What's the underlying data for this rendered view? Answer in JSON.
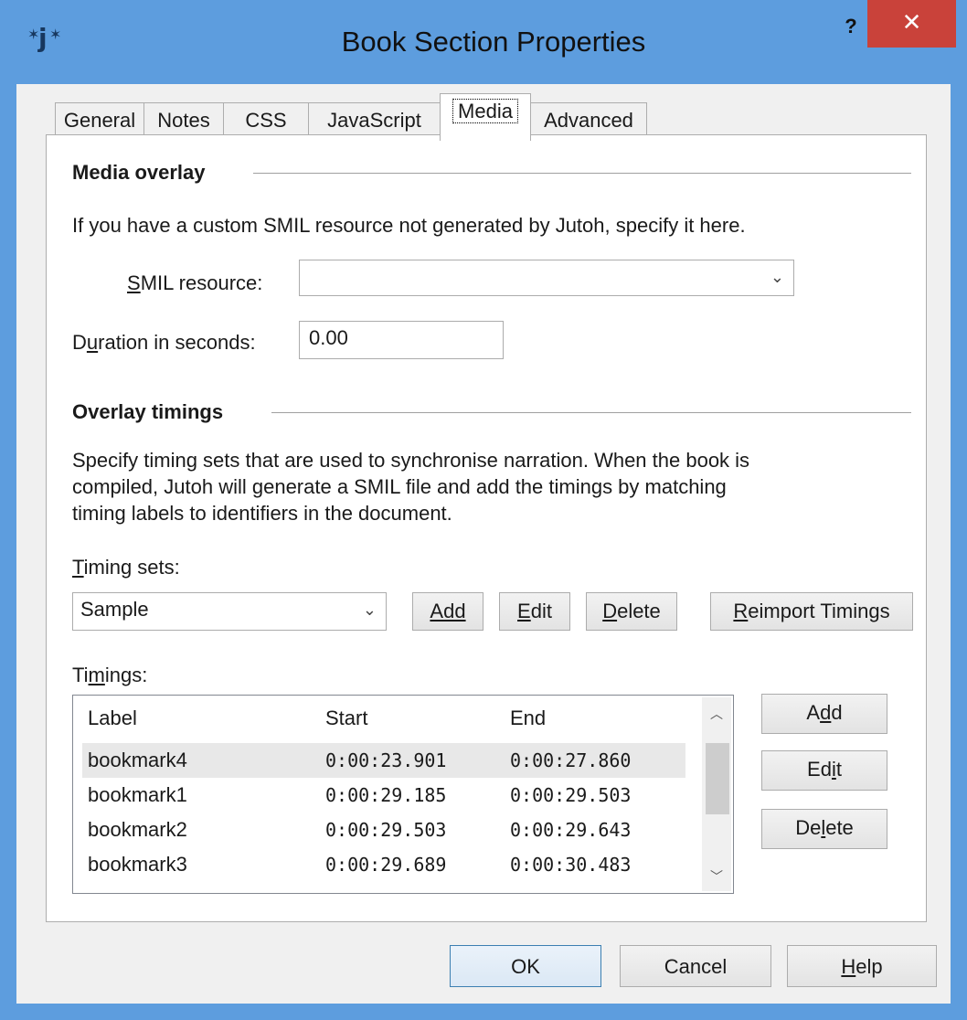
{
  "window": {
    "title": "Book Section Properties",
    "help_glyph": "?",
    "close_glyph": "✕",
    "app_icon_glyph": "j"
  },
  "tabs": [
    "General",
    "Notes",
    "CSS",
    "JavaScript",
    "Media",
    "Advanced"
  ],
  "active_tab": "Media",
  "media_overlay": {
    "heading": "Media overlay",
    "description": "If you have a custom SMIL resource not generated by Jutoh, specify it here.",
    "smil_label": "SMIL resource:",
    "smil_value": "",
    "duration_label": "Duration in seconds:",
    "duration_value": "0.00"
  },
  "overlay_timings": {
    "heading": "Overlay timings",
    "description_lines": [
      "Specify timing sets that are used to synchronise narration. When the book is",
      "compiled, Jutoh will generate a SMIL file and add the timings by matching",
      "timing labels to identifiers in the document."
    ],
    "timing_sets_label": "Timing sets:",
    "timing_set_value": "Sample",
    "set_buttons": [
      "Add",
      "Edit",
      "Delete",
      "Reimport Timings"
    ],
    "timings_label": "Timings:",
    "columns": [
      "Label",
      "Start",
      "End"
    ],
    "rows": [
      {
        "label": "bookmark4",
        "start": "0:00:23.901",
        "end": "0:00:27.860"
      },
      {
        "label": "bookmark1",
        "start": "0:00:29.185",
        "end": "0:00:29.503"
      },
      {
        "label": "bookmark2",
        "start": "0:00:29.503",
        "end": "0:00:29.643"
      },
      {
        "label": "bookmark3",
        "start": "0:00:29.689",
        "end": "0:00:30.483"
      }
    ],
    "row_buttons": [
      "Add",
      "Edit",
      "Delete"
    ]
  },
  "footer_buttons": {
    "ok": "OK",
    "cancel": "Cancel",
    "help": "Help"
  },
  "icons": {
    "chevron": "chevron-down-icon",
    "scroll_up": "scroll-up-icon",
    "scroll_down": "scroll-down-icon"
  }
}
